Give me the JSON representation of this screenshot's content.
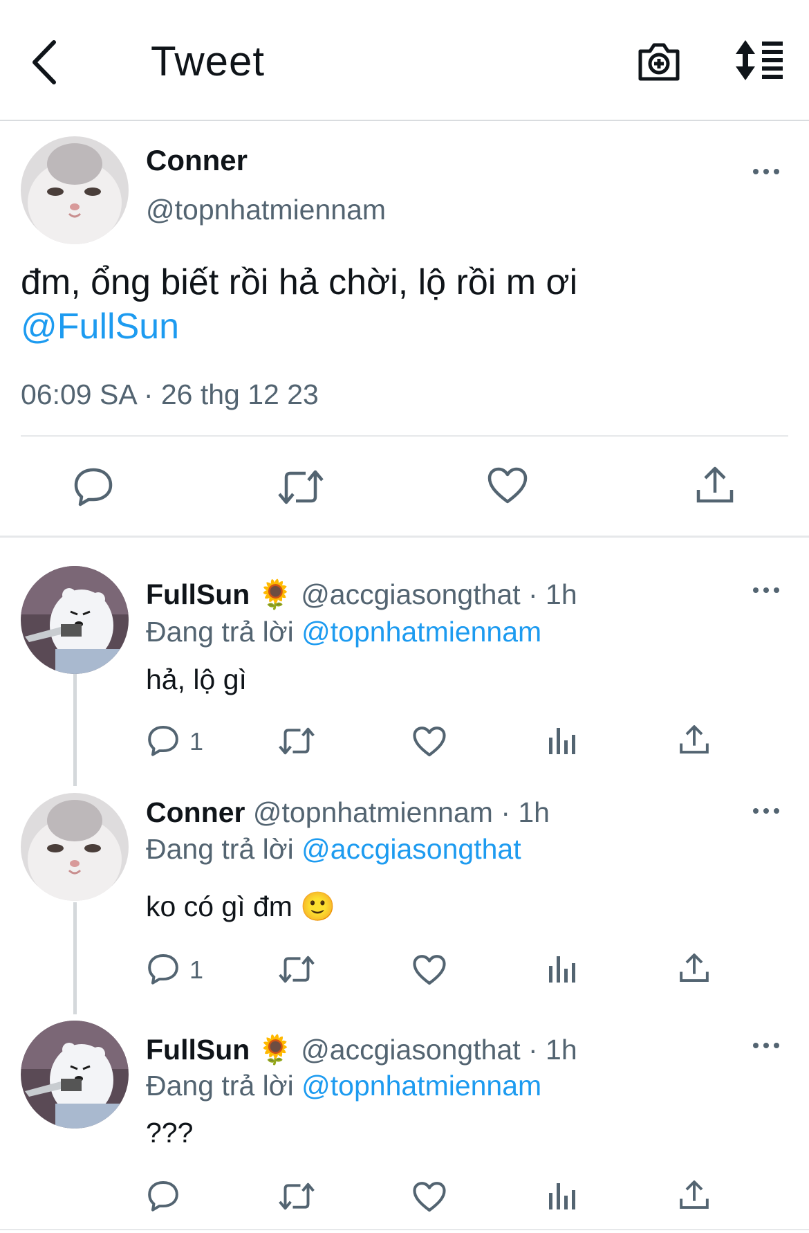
{
  "header": {
    "title": "Tweet"
  },
  "main_tweet": {
    "author_name": "Conner",
    "author_handle": "@topnhatmiennam",
    "text": "đm, ổng biết rồi hả chời, lộ rồi m ơi",
    "mention": "@FullSun",
    "timestamp": "06:09 SA · 26 thg 12 23"
  },
  "replies": [
    {
      "name": "FullSun",
      "badge": "🌻",
      "handle": "@accgiasongthat · 1h",
      "replying_prefix": "Đang trả lời",
      "replying_to": "@topnhatmiennam",
      "text": "hả, lộ gì",
      "reply_count": "1"
    },
    {
      "name": "Conner",
      "badge": "",
      "handle": "@topnhatmiennam · 1h",
      "replying_prefix": "Đang trả lời",
      "replying_to": "@accgiasongthat",
      "text": "ko có gì đm",
      "text_emoji": "🙂",
      "reply_count": "1"
    },
    {
      "name": "FullSun",
      "badge": "🌻",
      "handle": "@accgiasongthat · 1h",
      "replying_prefix": "Đang trả lời",
      "replying_to": "@topnhatmiennam",
      "text": "???",
      "reply_count": ""
    }
  ],
  "icons": {
    "back": "chevron-left-icon",
    "camera": "camera-plus-icon",
    "sort": "sort-icon",
    "reply": "reply-icon",
    "retweet": "retweet-icon",
    "like": "heart-icon",
    "views": "analytics-icon",
    "share": "share-icon",
    "more": "more-icon"
  },
  "colors": {
    "accent": "#1d9bf0",
    "secondary_text": "#536471",
    "primary_text": "#0f1419"
  }
}
